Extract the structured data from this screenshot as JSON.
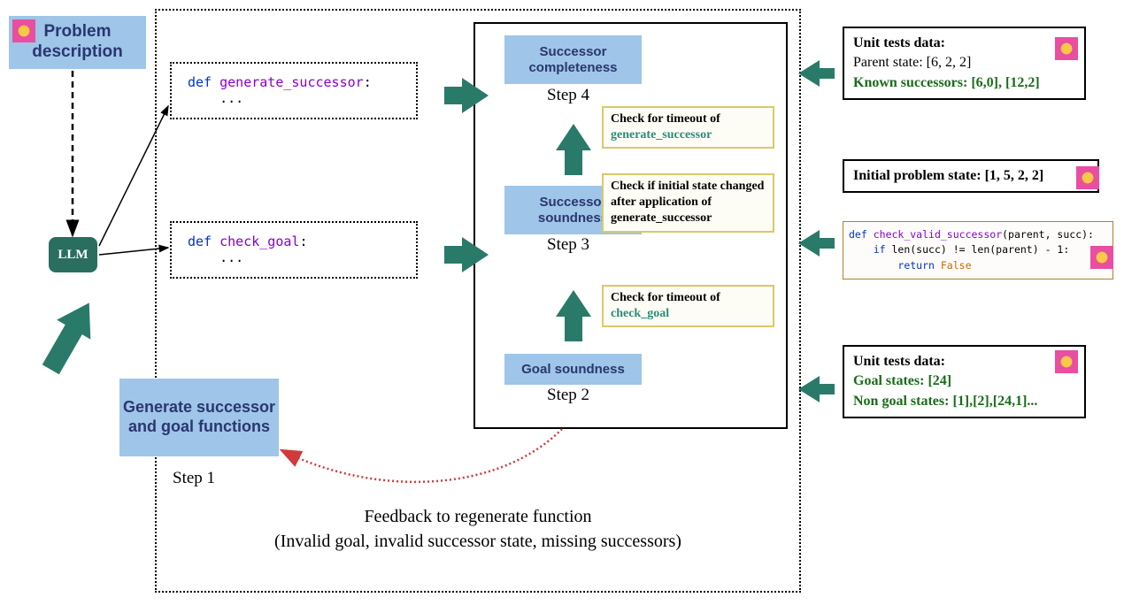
{
  "diagram": {
    "problem_description": "Problem description",
    "llm": "LLM",
    "generate_functions": "Generate successor and goal functions",
    "step1": "Step 1",
    "code1": {
      "kw": "def",
      "fn": "generate_successor",
      "tail": ":",
      "body": "..."
    },
    "code2": {
      "kw": "def",
      "fn": "check_goal",
      "tail": ":",
      "body": "..."
    },
    "validation": {
      "successor_completeness": "Successor completeness",
      "step4": "Step 4",
      "successor_soundness": "Successor soundness",
      "step3": "Step 3",
      "goal_soundness": "Goal soundness",
      "step2": "Step 2"
    },
    "checks": {
      "timeout_succ": {
        "pre": "Check for timeout of ",
        "fn": "generate_successor"
      },
      "initial_state": "Check if initial state changed after application of generate_successor",
      "timeout_goal": {
        "pre": "Check for timeout of ",
        "fn": "check_goal"
      }
    },
    "feedback": {
      "line1": "Feedback to regenerate function",
      "line2": "(Invalid goal, invalid successor state, missing successors)"
    },
    "right": {
      "ut1": {
        "title": "Unit tests data:",
        "parent_label": "Parent state: ",
        "parent_val": "[6, 2, 2]",
        "succ_label": "Known successors: ",
        "succ_val": "[6,0], [12,2]"
      },
      "ut2": {
        "label": "Initial problem state: ",
        "val": "[1, 5, 2, 2]"
      },
      "ut3": {
        "line1": {
          "kw": "def",
          "fn": "check_valid_successor",
          "args": "(parent, succ):"
        },
        "line2": {
          "kw": "if",
          "rest": " len(succ) != len(parent) - 1:"
        },
        "line3": {
          "kw": "return",
          "val": "False"
        }
      },
      "ut4": {
        "title": "Unit tests data:",
        "goal_label": "Goal states: ",
        "goal_val": "[24]",
        "nongoal_label": "Non goal states: ",
        "nongoal_val": "[1],[2],[24,1]..."
      }
    }
  }
}
